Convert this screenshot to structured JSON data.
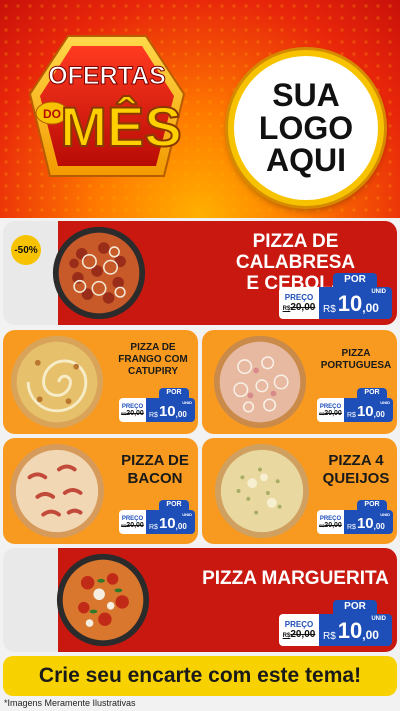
{
  "header": {
    "badge": {
      "line1": "OFERTAS",
      "line2": "DO",
      "line3": "MÊS"
    },
    "logo": {
      "line1": "SUA",
      "line2": "LOGO",
      "line3": "AQUI"
    }
  },
  "products": [
    {
      "name_line1": "PIZZA DE CALABRESA",
      "name_line2": "E CEBOLA",
      "discount": "-50%",
      "por": "POR",
      "preco": "PREÇO",
      "old_prefix": "R$",
      "old": "20,00",
      "currency": "R$",
      "int": "10",
      "dec": ",00",
      "unid": "UNID"
    },
    {
      "name_line1": "PIZZA DE",
      "name_line2": "FRANGO COM",
      "name_line3": "CATUPIRY",
      "por": "POR",
      "preco": "PREÇO",
      "old_prefix": "R$",
      "old": "20,00",
      "currency": "R$",
      "int": "10",
      "dec": ",00",
      "unid": "UNID"
    },
    {
      "name_line1": "PIZZA",
      "name_line2": "PORTUGUESA",
      "por": "POR",
      "preco": "PREÇO",
      "old_prefix": "R$",
      "old": "20,00",
      "currency": "R$",
      "int": "10",
      "dec": ",00",
      "unid": "UNID"
    },
    {
      "name_line1": "PIZZA DE",
      "name_line2": "BACON",
      "por": "POR",
      "preco": "PREÇO",
      "old_prefix": "R$",
      "old": "20,00",
      "currency": "R$",
      "int": "10",
      "dec": ",00",
      "unid": "UNID"
    },
    {
      "name_line1": "PIZZA 4",
      "name_line2": "QUEIJOS",
      "por": "POR",
      "preco": "PREÇO",
      "old_prefix": "R$",
      "old": "20,00",
      "currency": "R$",
      "int": "10",
      "dec": ",00",
      "unid": "UNID"
    },
    {
      "name_line1": "PIZZA MARGUERITA",
      "por": "POR",
      "preco": "PREÇO",
      "old_prefix": "R$",
      "old": "20,00",
      "currency": "R$",
      "int": "10",
      "dec": ",00",
      "unid": "UNID"
    }
  ],
  "footer": {
    "cta": "Crie seu encarte com este tema!",
    "disclaimer": "*Imagens Meramente Ilustrativas"
  },
  "colors": {
    "red": "#c9180f",
    "orange": "#f89a1f",
    "yellow": "#f7d200",
    "blue": "#1e4fb8"
  }
}
